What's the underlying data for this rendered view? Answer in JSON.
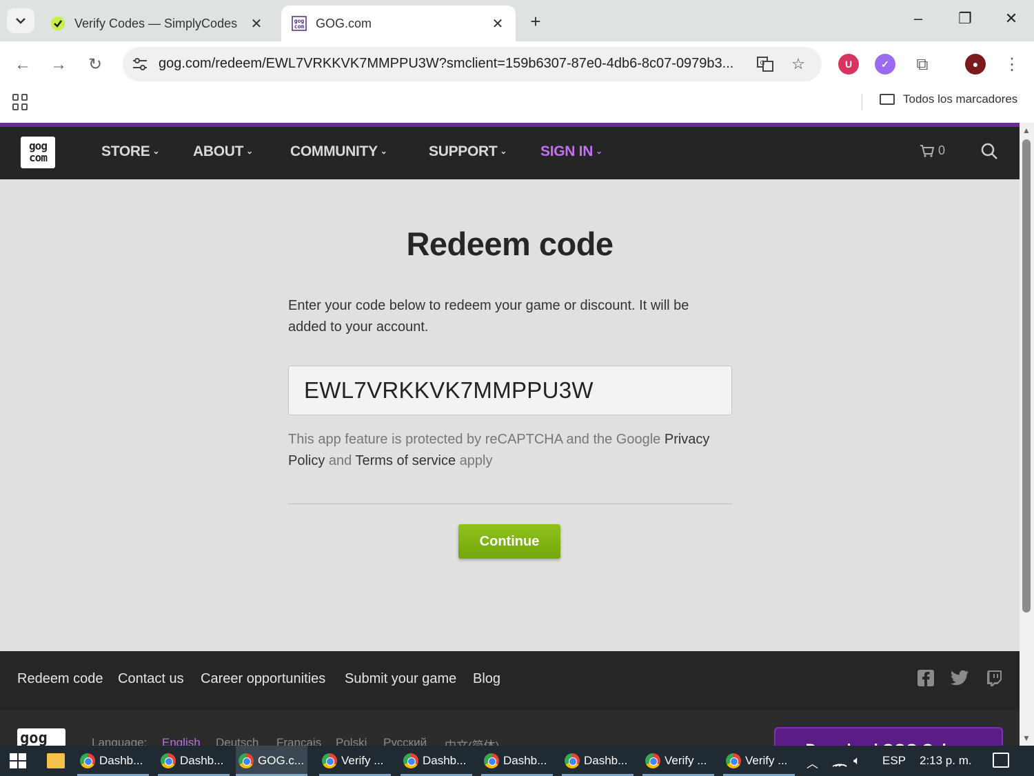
{
  "browser": {
    "tabs": [
      {
        "title": "Verify Codes — SimplyCodes",
        "active": false
      },
      {
        "title": "GOG.com",
        "active": true
      }
    ],
    "url": "gog.com/redeem/EWL7VRKKVK7MMPPU3W?smclient=159b6307-87e0-4db6-8c07-0979b3...",
    "bookmarks_all": "Todos los marcadores"
  },
  "site": {
    "logo": "gog com",
    "nav": {
      "store": "STORE",
      "about": "ABOUT",
      "community": "COMMUNITY",
      "support": "SUPPORT",
      "signin": "SIGN IN"
    },
    "cart_count": "0"
  },
  "redeem": {
    "title": "Redeem code",
    "intro": "Enter your code below to redeem your game or discount. It will be added to your account.",
    "code_value": "EWL7VRKKVK7MMPPU3W",
    "recaptcha_prefix": "This app feature is protected by reCAPTCHA and the Google ",
    "privacy_link": "Privacy Policy",
    "and_text": " and ",
    "terms_link": "Terms of service",
    "apply_text": " apply",
    "continue_label": "Continue"
  },
  "footer": {
    "links": [
      "Redeem code",
      "Contact us",
      "Career opportunities",
      "Submit your game",
      "Blog"
    ],
    "language_label": "Language:",
    "languages": [
      "English",
      "Deutsch",
      "Français",
      "Polski",
      "Русский",
      "中文(简体)"
    ],
    "download_label": "Download GOG Galaxy"
  },
  "taskbar": {
    "items": [
      "Dashb...",
      "Dashb...",
      "GOG.c...",
      "Verify ...",
      "Dashb...",
      "Dashb...",
      "Dashb...",
      "Verify ...",
      "Verify ..."
    ],
    "lang": "ESP",
    "time": "2:13 p. m."
  },
  "colors": {
    "accent_purple": "#c470f2",
    "continue_green": "#7ab212",
    "nav_bg": "#252525"
  }
}
